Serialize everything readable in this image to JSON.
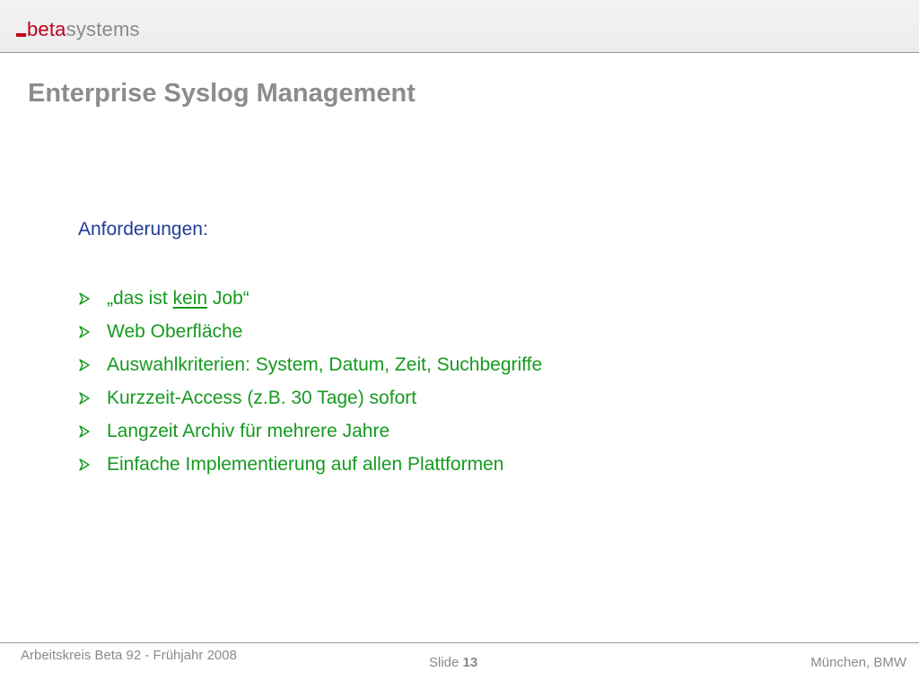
{
  "brand": {
    "logo_part1": "beta",
    "logo_part2": "systems",
    "accent_color": "#c0001a",
    "grey_color": "#8a8a8a"
  },
  "slide": {
    "title": "Enterprise Syslog Management",
    "heading": "Anforderungen:",
    "bullet_icon": "arrow-bullet-icon",
    "bullets": [
      {
        "before": "„das ist ",
        "emphasis": "kein",
        "after": " Job“"
      },
      {
        "text": "Web Oberfläche"
      },
      {
        "text": "Auswahlkriterien: System, Datum, Zeit, Suchbegriffe"
      },
      {
        "text": "Kurzzeit-Access (z.B. 30 Tage) sofort"
      },
      {
        "text": "Langzeit Archiv für mehrere Jahre"
      },
      {
        "text": "Einfache Implementierung auf allen Plattformen"
      }
    ],
    "heading_color": "#1f3d99",
    "bullet_color": "#159a1f"
  },
  "footer": {
    "left": "Arbeitskreis Beta 92 - Frühjahr 2008",
    "slide_label": "Slide",
    "slide_number": "13",
    "right": "München, BMW"
  }
}
